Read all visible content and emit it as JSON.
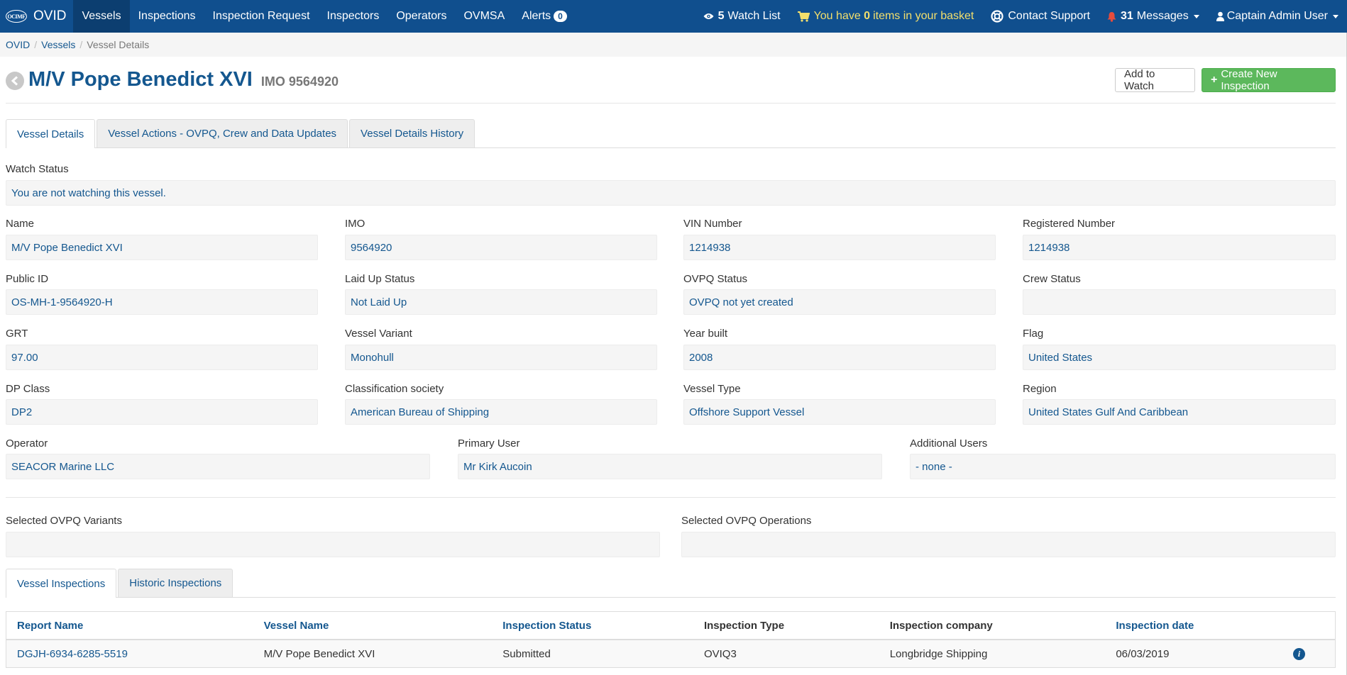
{
  "navbar": {
    "brand_logo_text": "OCIMF",
    "brand_name": "OVID",
    "items": [
      {
        "label": "Vessels",
        "active": true
      },
      {
        "label": "Inspections"
      },
      {
        "label": "Inspection Request"
      },
      {
        "label": "Inspectors"
      },
      {
        "label": "Operators"
      },
      {
        "label": "OVMSA"
      }
    ],
    "alerts_label": "Alerts",
    "alerts_count": "0",
    "watch_count": "5",
    "watch_label": "Watch List",
    "basket_prefix": "You have",
    "basket_count": "0",
    "basket_suffix": "items in your basket",
    "contact_label": "Contact Support",
    "messages_count": "31",
    "messages_label": "Messages",
    "user_label": "Captain Admin User"
  },
  "breadcrumb": {
    "items": [
      "OVID",
      "Vessels"
    ],
    "current": "Vessel Details"
  },
  "header": {
    "title": "M/V Pope Benedict XVI",
    "imo_label": "IMO 9564920",
    "watch_button": "Add to Watch",
    "create_button": "Create New Inspection"
  },
  "tabs": {
    "top": [
      "Vessel Details",
      "Vessel Actions - OVPQ, Crew and Data Updates",
      "Vessel Details History"
    ],
    "bottom": [
      "Vessel Inspections",
      "Historic Inspections"
    ]
  },
  "watch": {
    "label": "Watch Status",
    "value": "You are not watching this vessel."
  },
  "fields": {
    "name": {
      "label": "Name",
      "value": "M/V Pope Benedict XVI"
    },
    "imo": {
      "label": "IMO",
      "value": "9564920"
    },
    "vin": {
      "label": "VIN Number",
      "value": "1214938"
    },
    "registered": {
      "label": "Registered Number",
      "value": "1214938"
    },
    "public_id": {
      "label": "Public ID",
      "value": "OS-MH-1-9564920-H"
    },
    "laid_up": {
      "label": "Laid Up Status",
      "value": "Not Laid Up"
    },
    "ovpq_status": {
      "label": "OVPQ Status",
      "value": "OVPQ not yet created"
    },
    "crew_status": {
      "label": "Crew Status",
      "value": ""
    },
    "grt": {
      "label": "GRT",
      "value": "97.00"
    },
    "variant": {
      "label": "Vessel Variant",
      "value": "Monohull"
    },
    "year": {
      "label": "Year built",
      "value": "2008"
    },
    "flag": {
      "label": "Flag",
      "value": "United States"
    },
    "dp_class": {
      "label": "DP Class",
      "value": "DP2"
    },
    "class_society": {
      "label": "Classification society",
      "value": "American Bureau of Shipping"
    },
    "vessel_type": {
      "label": "Vessel Type",
      "value": "Offshore Support Vessel"
    },
    "region": {
      "label": "Region",
      "value": "United States Gulf And Caribbean"
    },
    "operator": {
      "label": "Operator",
      "value": "SEACOR Marine LLC"
    },
    "primary_user": {
      "label": "Primary User",
      "value": "Mr Kirk Aucoin"
    },
    "additional_users": {
      "label": "Additional Users",
      "value": "- none -"
    },
    "ovpq_variants": {
      "label": "Selected OVPQ Variants",
      "value": ""
    },
    "ovpq_operations": {
      "label": "Selected OVPQ Operations",
      "value": ""
    }
  },
  "table": {
    "headers": [
      "Report Name",
      "Vessel Name",
      "Inspection Status",
      "Inspection Type",
      "Inspection company",
      "Inspection date"
    ],
    "rows": [
      {
        "report": "DGJH-6934-6285-5519",
        "vessel": "M/V Pope Benedict XVI",
        "status": "Submitted",
        "type": "OVIQ3",
        "company": "Longbridge Shipping",
        "date": "06/03/2019"
      }
    ]
  },
  "colors": {
    "navbar": "#104f8e",
    "link": "#14578f",
    "success": "#5cb85c",
    "basket": "#f3df6c",
    "bell": "#e74c3c"
  }
}
